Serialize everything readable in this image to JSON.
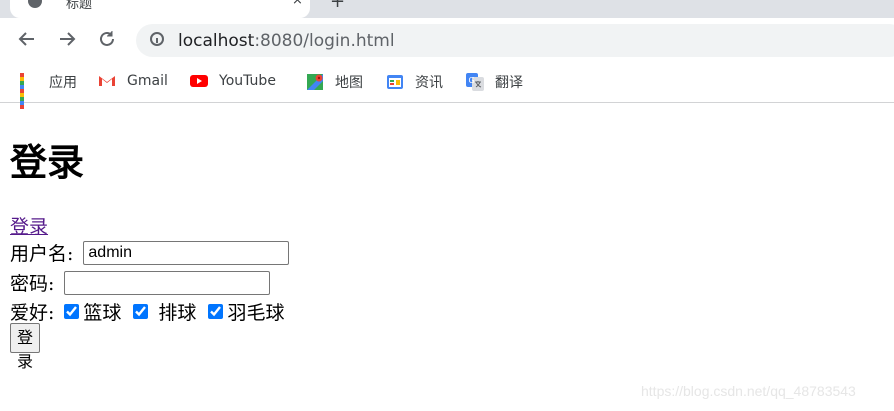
{
  "browser": {
    "tab": {
      "title": "标题",
      "close_glyph": "×"
    },
    "new_tab_glyph": "+",
    "address": {
      "host": "localhost",
      "rest": ":8080/login.html"
    },
    "bookmarks": [
      {
        "label": "应用",
        "icon": "apps-grid-icon"
      },
      {
        "label": "Gmail",
        "icon": "gmail-icon"
      },
      {
        "label": "YouTube",
        "icon": "youtube-icon"
      },
      {
        "label": "地图",
        "icon": "maps-icon"
      },
      {
        "label": "资讯",
        "icon": "news-icon"
      },
      {
        "label": "翻译",
        "icon": "translate-icon"
      }
    ]
  },
  "page": {
    "heading": "登录",
    "link_text": "登录",
    "username_label": "用户名:",
    "username_value": "admin",
    "password_label": "密码:",
    "password_value": "",
    "hobby_label": "爱好:",
    "hobbies": [
      {
        "label": "篮球",
        "checked": true
      },
      {
        "label": "排球",
        "checked": true
      },
      {
        "label": "羽毛球",
        "checked": true
      }
    ],
    "submit_label": "登录"
  },
  "watermark": "https://blog.csdn.net/qq_48783543",
  "colors": {
    "accent": "#0075ff",
    "visited_link": "#551a8b",
    "tabstrip": "#dee1e6",
    "omnibox": "#f1f3f4"
  }
}
